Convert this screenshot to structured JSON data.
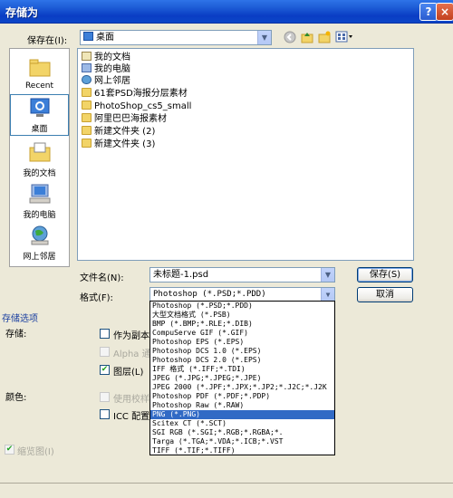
{
  "window": {
    "title": "存储为",
    "help_glyph": "?",
    "close_glyph": "×"
  },
  "save_in": {
    "label": "保存在(I):",
    "value": "桌面",
    "toolbar_icons": [
      "back-icon",
      "up-folder-icon",
      "new-folder-icon",
      "views-icon"
    ]
  },
  "places": [
    {
      "name": "Recent",
      "icon": "recent-icon"
    },
    {
      "name": "桌面",
      "icon": "desktop-icon",
      "selected": true
    },
    {
      "name": "我的文档",
      "icon": "my-documents-icon"
    },
    {
      "name": "我的电脑",
      "icon": "my-computer-icon"
    },
    {
      "name": "网上邻居",
      "icon": "network-places-icon"
    }
  ],
  "files": [
    {
      "name": "我的文档",
      "type": "doc"
    },
    {
      "name": "我的电脑",
      "type": "pc"
    },
    {
      "name": "网上邻居",
      "type": "net"
    },
    {
      "name": "61套PSD海报分层素材",
      "type": "folder"
    },
    {
      "name": "PhotoShop_cs5_small",
      "type": "folder"
    },
    {
      "name": "阿里巴巴海报素材",
      "type": "folder"
    },
    {
      "name": "新建文件夹 (2)",
      "type": "folder"
    },
    {
      "name": "新建文件夹 (3)",
      "type": "folder"
    }
  ],
  "filename": {
    "label": "文件名(N):",
    "value": "未标题-1.psd"
  },
  "format": {
    "label": "格式(F):",
    "value": "Photoshop (*.PSD;*.PDD)",
    "options": [
      "Photoshop (*.PSD;*.PDD)",
      "大型文档格式 (*.PSB)",
      "BMP (*.BMP;*.RLE;*.DIB)",
      "CompuServe GIF (*.GIF)",
      "Photoshop EPS (*.EPS)",
      "Photoshop DCS 1.0 (*.EPS)",
      "Photoshop DCS 2.0 (*.EPS)",
      "IFF 格式 (*.IFF;*.TDI)",
      "JPEG (*.JPG;*.JPEG;*.JPE)",
      "JPEG 2000 (*.JPF;*.JPX;*.JP2;*.J2C;*.J2K",
      "Photoshop PDF (*.PDF;*.PDP)",
      "Photoshop Raw (*.RAW)",
      "PNG (*.PNG)",
      "Scitex CT (*.SCT)",
      "SGI RGB (*.SGI;*.RGB;*.RGBA;*.",
      "Targa (*.TGA;*.VDA;*.ICB;*.VST",
      "TIFF (*.TIF;*.TIFF)"
    ],
    "selected_index": 12
  },
  "buttons": {
    "save": "保存(S)",
    "cancel": "取消"
  },
  "storage_options": {
    "header": "存储选项",
    "storage_label": "存储:",
    "as_copy": "作为副本(",
    "alpha": "Alpha 通",
    "layers": "图层(L)",
    "color_label": "颜色:",
    "use_proof": "使用校样",
    "icc": "ICC 配置文",
    "thumbnail": "缩览图(I)"
  }
}
